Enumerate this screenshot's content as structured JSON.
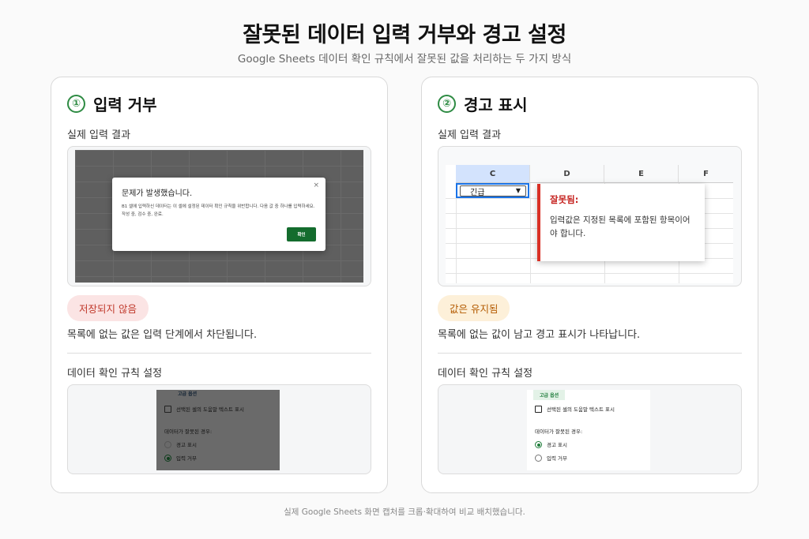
{
  "title": "잘못된 데이터 입력 거부와 경고 설정",
  "subtitle": "Google Sheets 데이터 확인 규칙에서 잘못된 값을 처리하는 두 가지 방식",
  "footer": "실제 Google Sheets 화면 캡처를 크롭·확대하여 비교 배치했습니다.",
  "left": {
    "number": "①",
    "name": "입력 거부",
    "result_label": "실제 입력 결과",
    "dialog": {
      "title": "문제가 발생했습니다.",
      "close": "×",
      "message": "B1 셀에 입력하신 데이터는 이 셀에 설정된 데이터 확인 규칙을 위반합니다. 다음 값 중 하나를 입력하세요. 작성 중, 검수 중, 완료.",
      "ok": "확인"
    },
    "badge": "저장되지 않음",
    "description": "목록에 없는 값은 입력 단계에서 차단됩니다.",
    "rules_label": "데이터 확인 규칙 설정",
    "rules": {
      "advanced": "고급 옵션",
      "help_text": "선택된 셀의 도움말 텍스트 표시",
      "invalid_label": "데이터가 잘못된 경우:",
      "option_warn": "경고 표시",
      "option_reject": "입력 거부",
      "selected": "reject"
    }
  },
  "right": {
    "number": "②",
    "name": "경고 표시",
    "result_label": "실제 입력 결과",
    "sheet": {
      "columns": [
        "C",
        "D",
        "E",
        "F"
      ],
      "cell_value": "긴급",
      "warning_title": "잘못됨:",
      "warning_message": "입력값은 지정된 목록에 포함된 항목이어야 합니다."
    },
    "badge": "값은 유지됨",
    "description": "목록에 없는 값이 남고 경고 표시가 나타납니다.",
    "rules_label": "데이터 확인 규칙 설정",
    "rules": {
      "advanced": "고급 옵션",
      "help_text": "선택된 셀의 도움말 텍스트 표시",
      "invalid_label": "데이터가 잘못된 경우:",
      "option_warn": "경고 표시",
      "option_reject": "입력 거부",
      "selected": "warn"
    }
  },
  "colors": {
    "accent_green": "#2e8b43",
    "error_red": "#d93025",
    "badge_red_bg": "#fbe4e4",
    "badge_orange_bg": "#fdf0d9"
  }
}
